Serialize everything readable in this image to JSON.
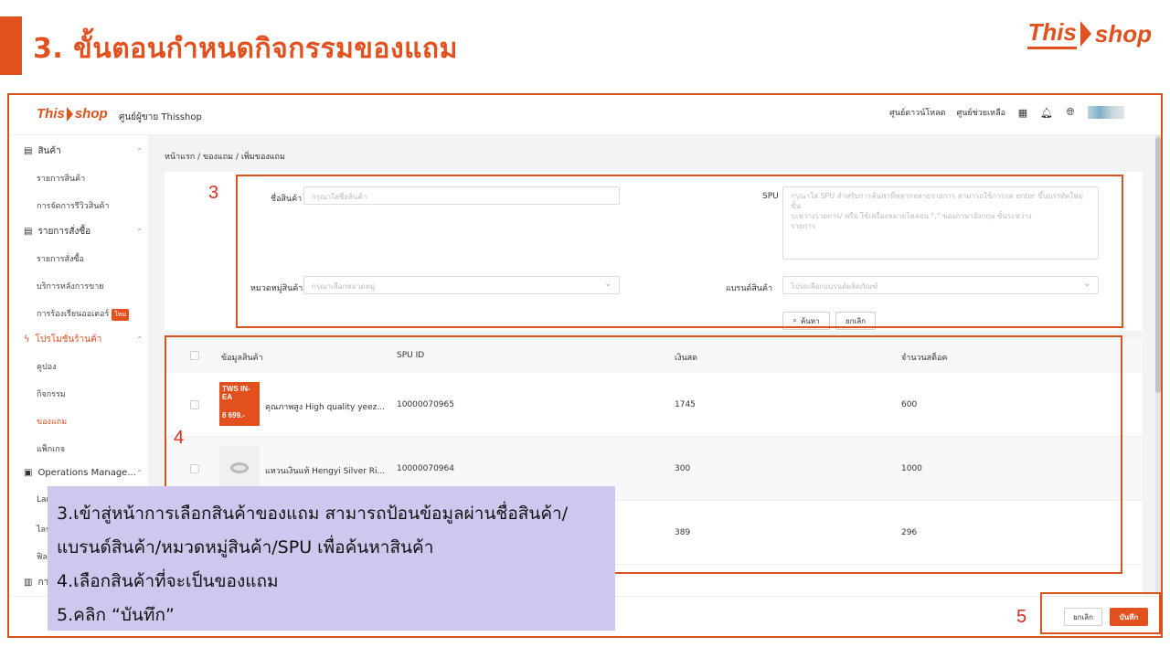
{
  "slide": {
    "title": "3. ขั้นตอนกำหนดกิจกรรมของแถม",
    "logo_this": "This",
    "logo_shop": "shop"
  },
  "app": {
    "logo_this": "This",
    "logo_shop": "shop",
    "seller_center": "ศูนย์ผู้ขาย Thisshop",
    "download_center": "ศูนย์ดาวน์โหลด",
    "help_center": "ศูนย์ช่วยเหลือ"
  },
  "sidebar": {
    "groups": [
      {
        "label": "สินค้า",
        "items": [
          "รายการสินค้า",
          "การจัดการรีวิวสินค้า"
        ]
      },
      {
        "label": "รายการสั่งซื้อ",
        "items": [
          "รายการสั่งซื้อ",
          "บริการหลังการขาย",
          "การร้องเรียนออเดอร์"
        ]
      },
      {
        "label": "โปรโมชั่นร้านค้า",
        "items": [
          "คูปอง",
          "กิจกรรม",
          "ของแถม",
          "แพ็กเกจ"
        ]
      },
      {
        "label": "Operations Manage...",
        "items": [
          "Lan",
          "ไลฟ์",
          "ฟิล"
        ]
      },
      {
        "label": "กา",
        "items": []
      }
    ],
    "new_badge": "ใหม่"
  },
  "breadcrumb": "หน้าแรก / ของแถม / เพิ่มของแถม",
  "form": {
    "product_name_label": "ชื่อสินค้า",
    "product_name_placeholder": "กรุณาใส่ชื่อสินค้า",
    "spu_label": "SPU",
    "spu_placeholder_1": "กรุณาใส่ SPU สำหรับการค้นหาที่หลากหลายรายการ สามารถใช้การกด enter ขึ้นบรรทัดใหม่ ขั้น",
    "spu_placeholder_2": "ระหว่างรายการ/ หรือ ใช้เครื่องหมายโคลอน \",\" ของภาษาอังกฤษ ขั้นระหว่าง",
    "spu_placeholder_3": "รายการ",
    "category_label": "หมวดหมู่สินค้า",
    "category_placeholder": "กรุณาเลือกหมวดหมู่",
    "brand_label": "แบรนด์สินค้า",
    "brand_placeholder": "โปรดเลือกแบรนด์ผลิตภัณฑ์",
    "search_button": "ค้นหา",
    "reset_button": "ยกเลิก"
  },
  "table": {
    "headers": [
      "ข้อมูลสินค้า",
      "SPU ID",
      "เงินสด",
      "จำนวนสต็อค"
    ],
    "rows": [
      {
        "name": "คุณภาพสูง High quality yeez...",
        "spu": "10000070965",
        "price": "1745",
        "stock": "600",
        "thumb_line1": "TWS IN-EA",
        "thumb_line2": "8 699.-"
      },
      {
        "name": "แหวนเงินแท้ Hengyi Silver Ri...",
        "spu": "10000070964",
        "price": "300",
        "stock": "1000"
      },
      {
        "name": "",
        "spu": "",
        "price": "389",
        "stock": "296"
      }
    ]
  },
  "footer": {
    "cancel": "ยกเลิก",
    "save": "บันทึก"
  },
  "annotations": {
    "n3": "3",
    "n4": "4",
    "n5": "5"
  },
  "callout": {
    "line1": "3.เข้าสู่หน้าการเลือกสินค้าของแถม สามารถป้อนข้อมูลผ่านชื่อสินค้า/",
    "line2": "แบรนด์สินค้า/หมวดหมู่สินค้า/SPU เพื่อค้นหาสินค้า",
    "line3": "4.เลือกสินค้าที่จะเป็นของแถม",
    "line4": "5.คลิก “บันทึก”"
  },
  "colors": {
    "brand": "#e2501e",
    "annotation_red": "#d92d1e",
    "callout_bg": "#cfc8ee"
  }
}
